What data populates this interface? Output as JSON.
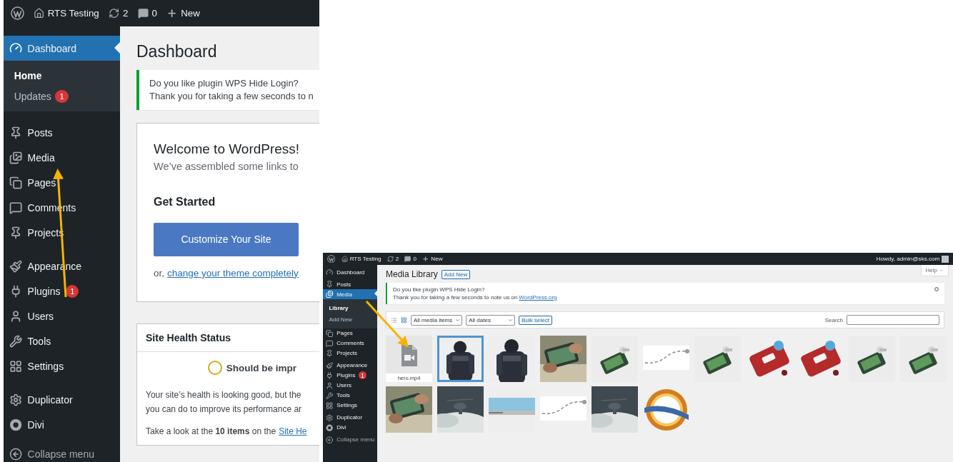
{
  "dashboard_screen": {
    "admin_bar": {
      "site": "RTS Testing",
      "updates": "2",
      "comments": "0",
      "new": "New"
    },
    "menu": {
      "groups": [
        [
          {
            "label": "Dashboard",
            "selected": true,
            "children": [
              {
                "label": "Home",
                "selected": true
              },
              {
                "label": "Updates",
                "badge": "1",
                "selected": false
              }
            ]
          }
        ],
        [
          {
            "label": "Posts",
            "selected": false
          },
          {
            "label": "Media",
            "selected": false
          },
          {
            "label": "Pages",
            "selected": false
          },
          {
            "label": "Comments",
            "selected": false
          },
          {
            "label": "Projects",
            "selected": false
          }
        ],
        [
          {
            "label": "Appearance",
            "selected": false
          },
          {
            "label": "Plugins",
            "badge": "1",
            "selected": false
          },
          {
            "label": "Users",
            "selected": false
          },
          {
            "label": "Tools",
            "selected": false
          },
          {
            "label": "Settings",
            "selected": false
          }
        ],
        [
          {
            "label": "Duplicator",
            "selected": false
          },
          {
            "label": "Divi",
            "selected": false
          }
        ]
      ],
      "collapse": "Collapse menu"
    },
    "title": "Dashboard",
    "notice": {
      "lines": [
        "Do you like plugin WPS Hide Login?",
        "Thank you for taking a few seconds to n"
      ]
    },
    "welcome": {
      "title": "Welcome to WordPress!",
      "subtitle": "We’ve assembled some links to",
      "heading": "Get Started",
      "button": "Customize Your Site",
      "alt_prefix": "or,",
      "alt_link": "change your theme completely"
    },
    "site_health": {
      "title": "Site Health Status",
      "status": "Should be impr",
      "lines": [
        "Your site’s health is looking good, but the",
        "you can do to improve its performance ar"
      ],
      "look_text": "Take a look at the **10 items** on the",
      "look_link": "Site He"
    }
  },
  "media_screen": {
    "admin_bar": {
      "site": "RTS Testing",
      "updates": "2",
      "comments": "0",
      "new": "New",
      "greeting": "Howdy, admin@sks.com"
    },
    "menu": {
      "groups": [
        [
          {
            "label": "Dashboard",
            "selected": false
          }
        ],
        [
          {
            "label": "Posts",
            "selected": false
          },
          {
            "label": "Media",
            "selected": true,
            "children": [
              {
                "label": "Library",
                "selected": true
              },
              {
                "label": "Add New",
                "selected": false
              }
            ]
          },
          {
            "label": "Pages",
            "selected": false
          },
          {
            "label": "Comments",
            "selected": false
          },
          {
            "label": "Projects",
            "selected": false
          }
        ],
        [
          {
            "label": "Appearance",
            "selected": false
          },
          {
            "label": "Plugins",
            "badge": "1",
            "selected": false
          },
          {
            "label": "Users",
            "selected": false
          },
          {
            "label": "Tools",
            "selected": false
          },
          {
            "label": "Settings",
            "selected": false
          }
        ],
        [
          {
            "label": "Duplicator",
            "selected": false
          },
          {
            "label": "Divi",
            "selected": false
          }
        ]
      ],
      "collapse": "Collapse menu"
    },
    "title": "Media Library",
    "add_new": "Add New",
    "help": "Help",
    "notice": {
      "line1": "Do you like plugin WPS Hide Login?",
      "line2": "Thank you for taking a few seconds to note us on",
      "link": "WordPress.org"
    },
    "filters": {
      "views": [
        {
          "selected": false
        },
        {
          "selected": true
        }
      ],
      "type": "All media items",
      "date": "All dates",
      "bulk": "Bulk select",
      "search_label": "Search"
    },
    "items": [
      {
        "kind": "file",
        "filename": "hero.mp4",
        "selected": false
      },
      {
        "kind": "picture",
        "selected": true
      },
      {
        "kind": "picture",
        "selected": false
      },
      {
        "kind": "picture",
        "selected": false
      },
      {
        "kind": "picture",
        "selected": false
      },
      {
        "kind": "picture",
        "selected": false
      },
      {
        "kind": "picture",
        "selected": false
      },
      {
        "kind": "picture",
        "selected": false
      },
      {
        "kind": "picture",
        "selected": false
      },
      {
        "kind": "picture",
        "selected": false
      },
      {
        "kind": "picture",
        "selected": false
      },
      {
        "kind": "picture",
        "selected": false
      },
      {
        "kind": "picture",
        "selected": false
      },
      {
        "kind": "picture",
        "selected": false
      },
      {
        "kind": "picture",
        "selected": false
      },
      {
        "kind": "picture",
        "selected": false
      },
      {
        "kind": "picture",
        "selected": false
      }
    ]
  }
}
